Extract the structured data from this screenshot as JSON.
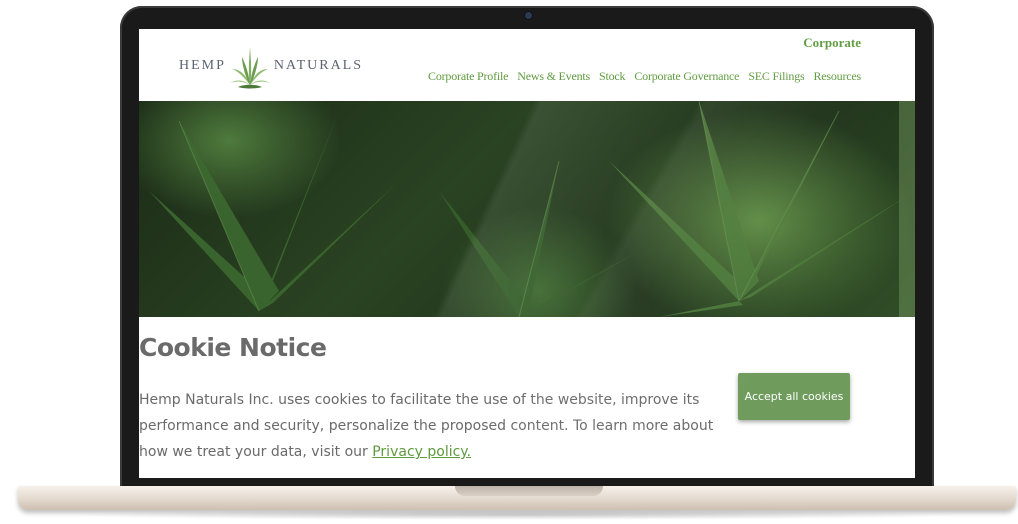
{
  "header": {
    "corporate_label": "Corporate",
    "logo": {
      "left_text": "HEMP",
      "right_text": "NATURALS",
      "icon": "hemp-leaf-icon"
    },
    "nav": [
      {
        "label": "Corporate Profile"
      },
      {
        "label": "News & Events"
      },
      {
        "label": "Stock"
      },
      {
        "label": "Corporate Governance"
      },
      {
        "label": "SEC Filings"
      },
      {
        "label": "Resources"
      }
    ]
  },
  "cookie_notice": {
    "title": "Cookie Notice",
    "body_text": "Hemp Naturals Inc. uses cookies to facilitate the use of the website, improve its performance and security, personalize the proposed content. To learn more about how we treat your data, visit our ",
    "privacy_link": "Privacy policy.",
    "accept_button": "Accept all cookies"
  },
  "colors": {
    "brand_green": "#5e9a3e",
    "button_green": "#6f9c5c",
    "text_gray": "#6a6a6a"
  }
}
